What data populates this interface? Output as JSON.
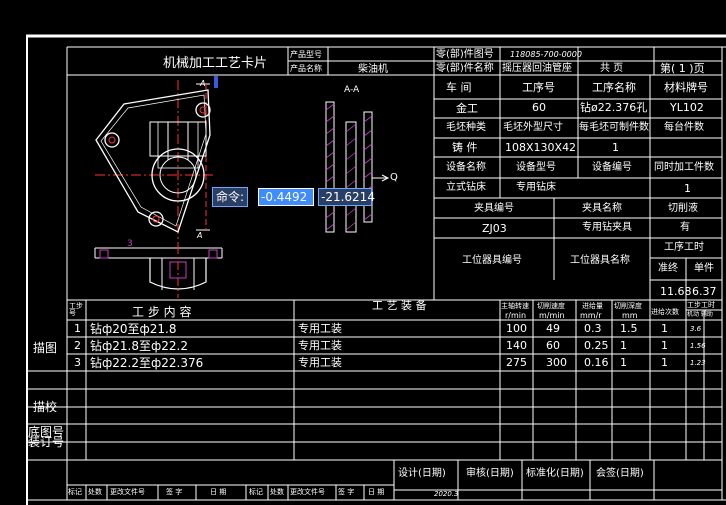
{
  "card": {
    "title": "机械加工工艺卡片",
    "product_model_label": "产品型号",
    "product_name_label": "产品名称",
    "product_name_value": "柴油机",
    "part_drawing_no_label": "零(部)件图号",
    "part_drawing_no_value": "118085-700-0000",
    "part_name_label": "零(部)件名称",
    "part_name_value": "摇压器回油管座",
    "total_pages": "共 页",
    "page_no": "第( 1 )页"
  },
  "info": {
    "workshop_label": "车 间",
    "op_no_label": "工序号",
    "op_name_label": "工序名称",
    "material_label": "材料牌号",
    "workshop_value": "金工",
    "op_no_value": "60",
    "op_name_value": "钻ø22.376孔",
    "material_value": "YL102",
    "blank_type_label": "毛坯种类",
    "blank_size_label": "毛坯外型尺寸",
    "pieces_per_blank_label": "每毛坯可制件数",
    "pieces_per_unit_label": "每台件数",
    "blank_type_value": "铸 件",
    "blank_size_value": "108X130X42",
    "pieces_per_blank_value": "1",
    "equip_name_label": "设备名称",
    "equip_model_label": "设备型号",
    "equip_no_label": "设备编号",
    "simultaneous_label": "同时加工件数",
    "equip_name_value": "立式钻床",
    "equip_model_value": "专用钻床",
    "simultaneous_value": "1",
    "fixture_no_label": "夹具编号",
    "fixture_name_label": "夹具名称",
    "coolant_label": "切削液",
    "fixture_no_value": "ZJ03",
    "fixture_name_value": "专用钻夹具",
    "coolant_value": "有",
    "station_tool_no_label": "工位器具编号",
    "station_tool_name_label": "工位器具名称",
    "op_time_label": "工序工时",
    "prep_label": "准终",
    "unit_label": "单件",
    "prep_value": "11.68",
    "unit_value": "6.37"
  },
  "drawing": {
    "section_label": "A-A",
    "a_top": "A",
    "a_bottom": "A",
    "q_label": "Q",
    "mark_3": "3"
  },
  "command": {
    "label": "命令:",
    "x_value": "-0.4492",
    "y_value": "-21.6214"
  },
  "steps": {
    "header_no": "工步号",
    "header_content": "工 步 内 容",
    "header_equip": "工 艺 装 备",
    "header_speed": "主轴转速",
    "header_speed_unit": "r/min",
    "header_cut": "切削速度",
    "header_cut_unit": "m/min",
    "header_feed": "进给量",
    "header_feed_unit": "mm/r",
    "header_depth": "切削深度",
    "header_depth_unit": "mm",
    "header_passes": "进给次数",
    "header_time": "工步工时",
    "header_time_sub": "机动 辅助",
    "rows": [
      {
        "no": "1",
        "content": "钻ф20至ф21.8",
        "equip": "专用工装",
        "speed": "100",
        "cut": "49",
        "feed": "0.3",
        "depth": "1.5",
        "passes": "1",
        "time": "3.6"
      },
      {
        "no": "2",
        "content": "钻ф21.8至ф22.2",
        "equip": "专用工装",
        "speed": "140",
        "cut": "60",
        "feed": "0.25",
        "depth": "1",
        "passes": "1",
        "time": "1.56"
      },
      {
        "no": "3",
        "content": "钻ф22.2至ф22.376",
        "equip": "专用工装",
        "speed": "275",
        "cut": "300",
        "feed": "0.16",
        "depth": "1",
        "passes": "1",
        "time": "1.23"
      }
    ]
  },
  "left_labels": {
    "trace": "描图",
    "check": "描校",
    "base_no": "底图号",
    "binding_no": "装订号"
  },
  "footer": {
    "design": "设计(日期)",
    "review": "审核(日期)",
    "standard": "标准化(日期)",
    "sign": "会签(日期)",
    "date": "2020.3",
    "mark": "标记",
    "place_count": "处数",
    "change_doc": "更改文件号",
    "signature": "签 字",
    "date_label": "日 期"
  }
}
